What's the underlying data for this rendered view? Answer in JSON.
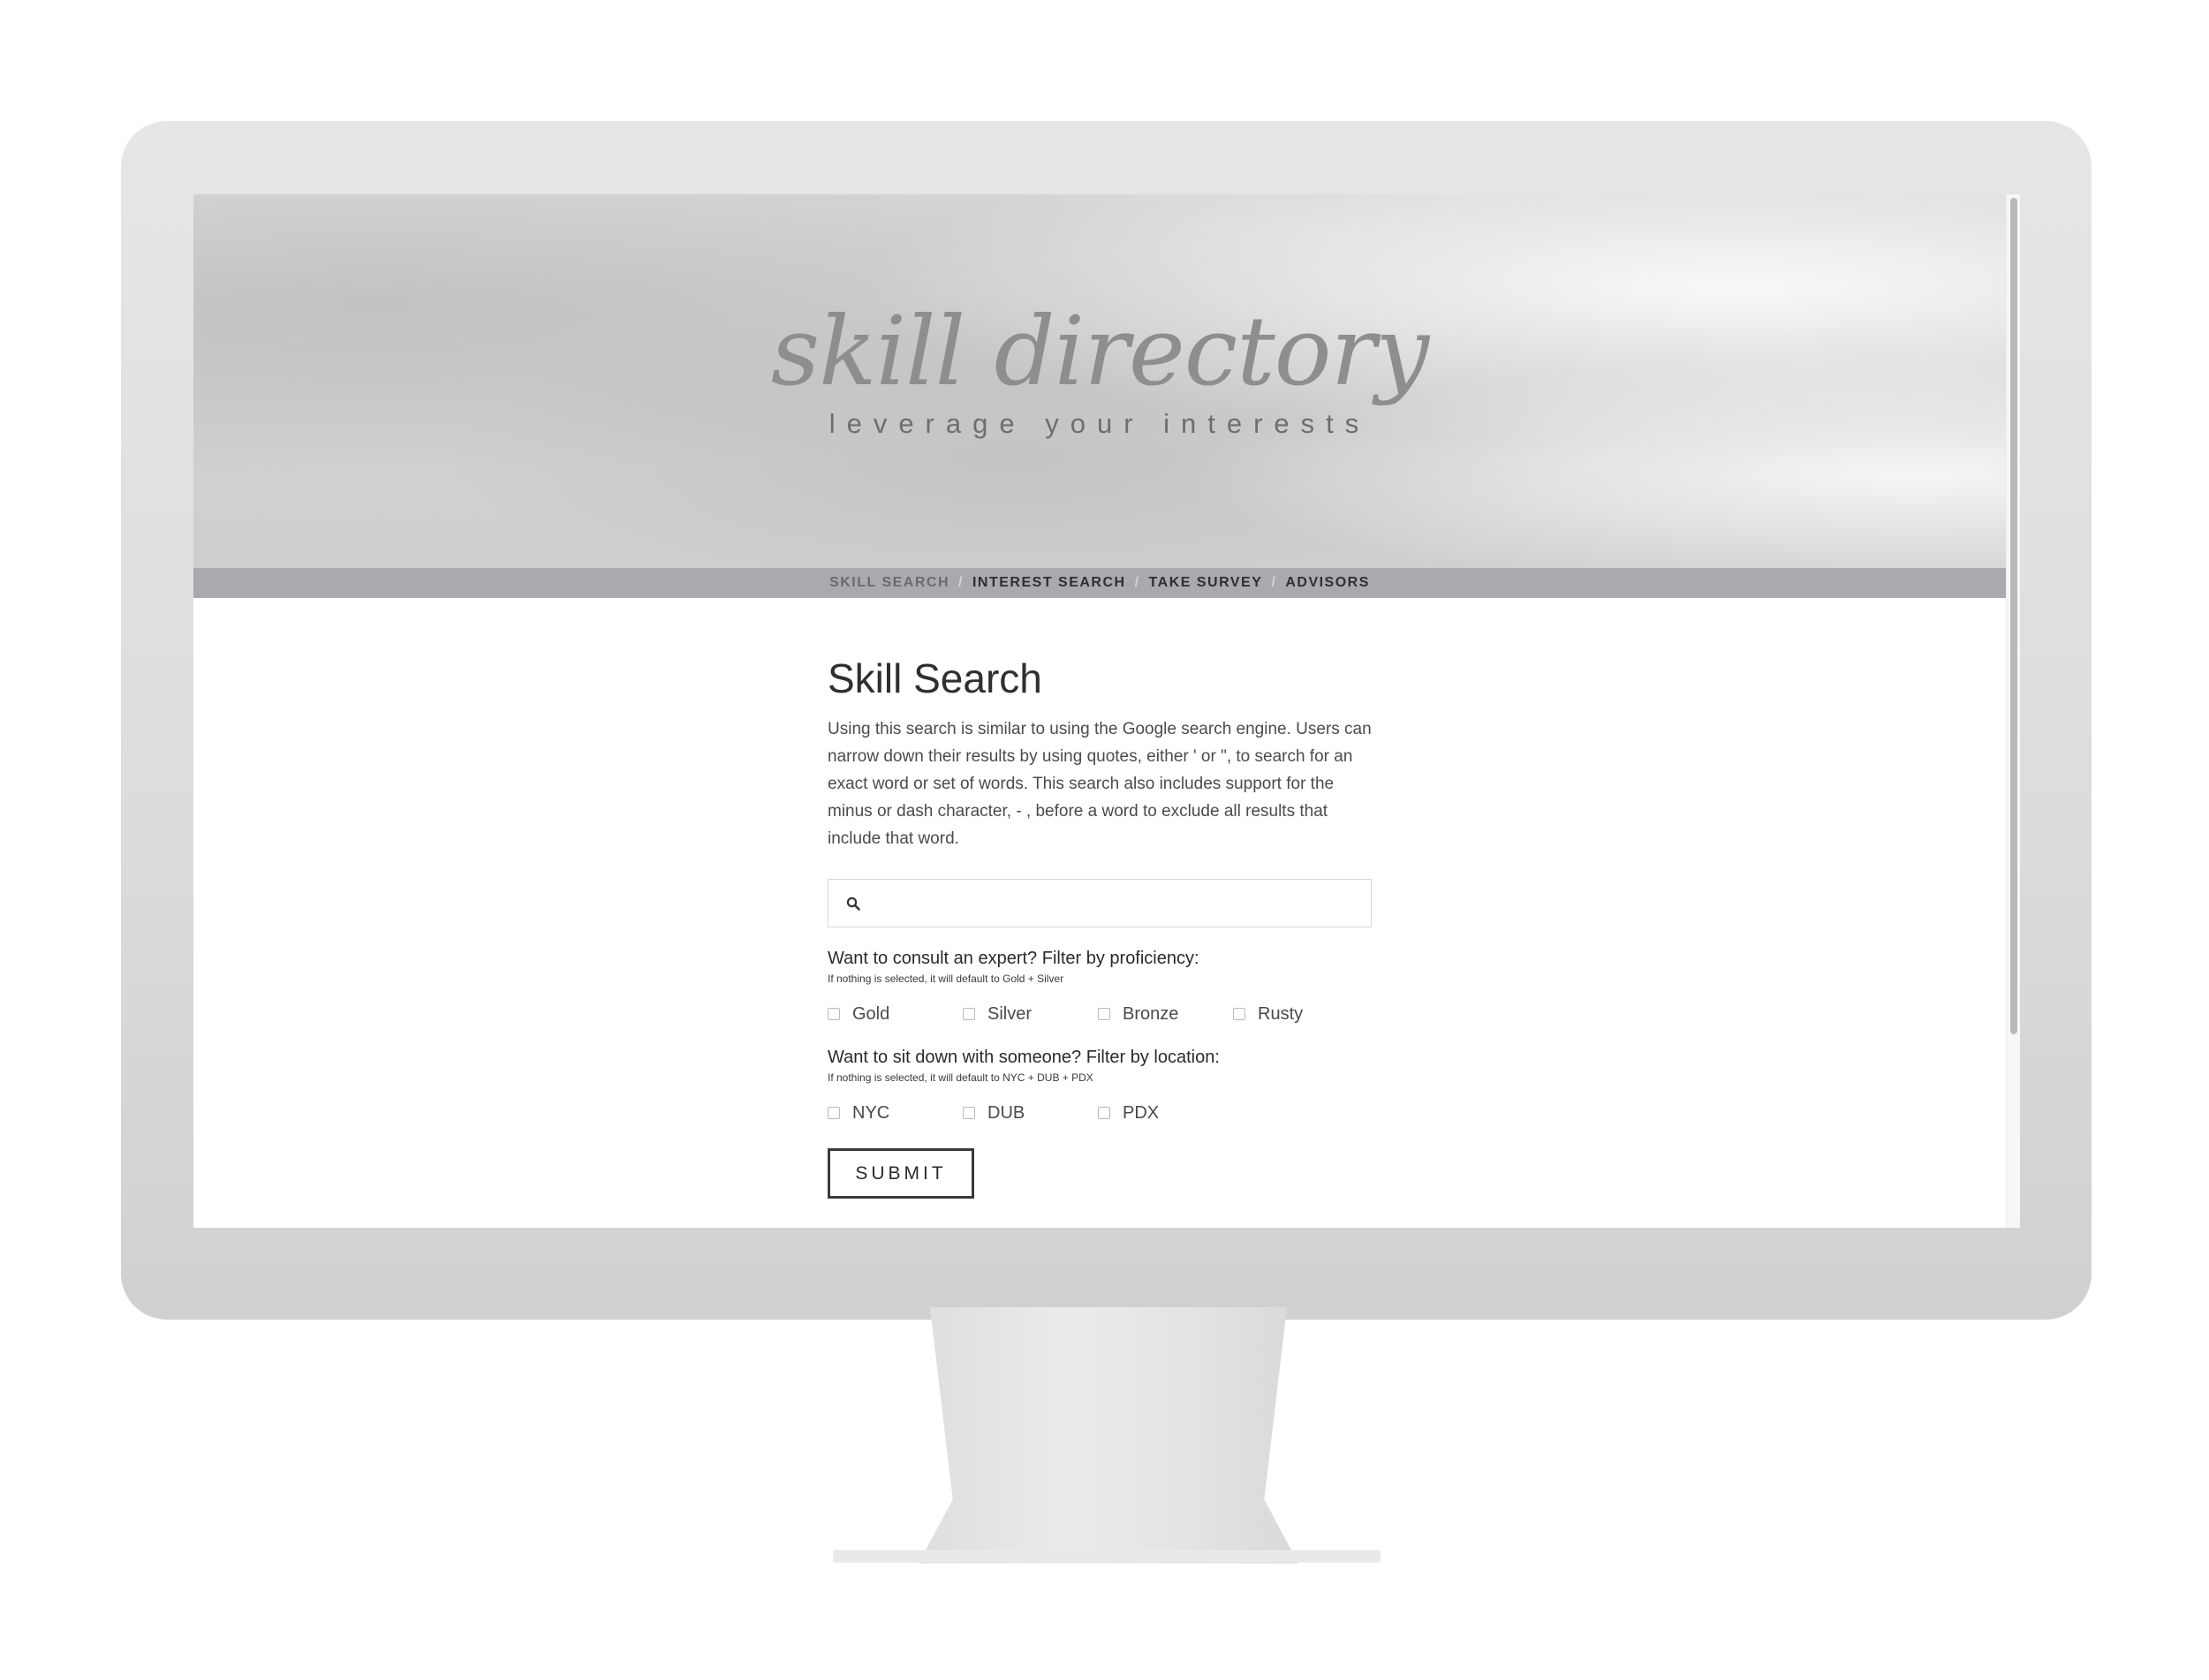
{
  "header": {
    "title": "skill directory",
    "tagline": "leverage your interests"
  },
  "nav": {
    "items": [
      {
        "label": "SKILL SEARCH",
        "active": true
      },
      {
        "label": "INTEREST SEARCH",
        "active": false
      },
      {
        "label": "TAKE SURVEY",
        "active": false
      },
      {
        "label": "ADVISORS",
        "active": false
      }
    ],
    "separator": "/"
  },
  "main": {
    "title": "Skill Search",
    "intro": "Using this search is similar to using the Google search engine. Users can narrow down their results by using quotes, either ' or \", to search for an exact word or set of words. This search also includes support for the minus or dash character, - , before a word to exclude all results that include that word.",
    "search": {
      "value": "",
      "placeholder": ""
    },
    "proficiency": {
      "label": "Want to consult an expert? Filter by proficiency:",
      "note": "If nothing is selected, it will default to Gold + Silver",
      "options": [
        "Gold",
        "Silver",
        "Bronze",
        "Rusty"
      ]
    },
    "location": {
      "label": "Want to sit down with someone? Filter by location:",
      "note": "If nothing is selected, it will default to NYC + DUB + PDX",
      "options": [
        "NYC",
        "DUB",
        "PDX"
      ]
    },
    "submit_label": "SUBMIT"
  },
  "colors": {
    "nav_bar": "#a9a9ae",
    "hero_background": "#d2d2d2",
    "title_text": "#8e8e8e"
  }
}
